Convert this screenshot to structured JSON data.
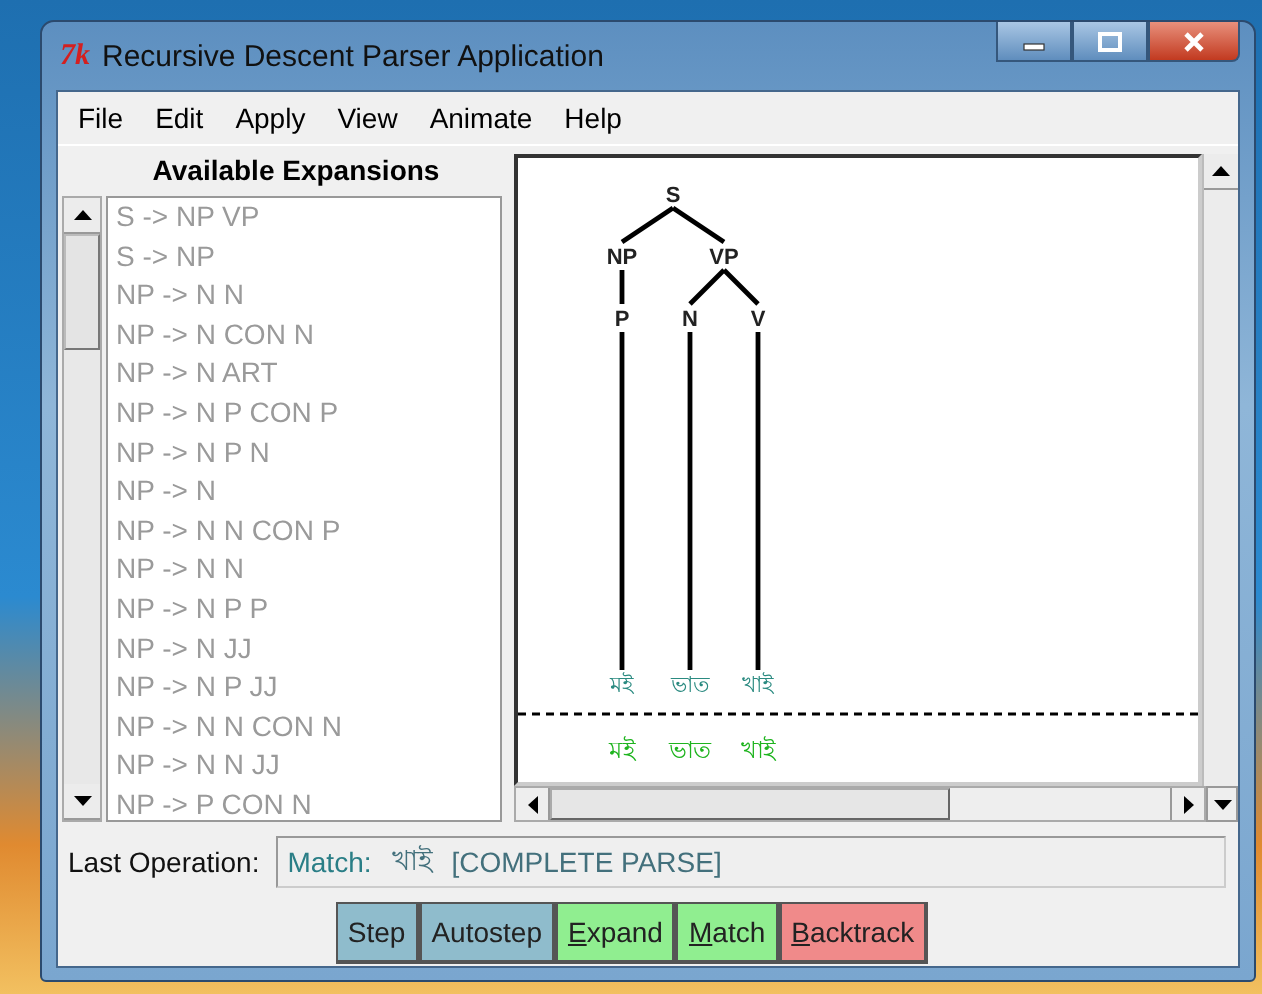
{
  "window": {
    "logo": "7k",
    "title": "Recursive Descent Parser Application"
  },
  "menu": [
    "File",
    "Edit",
    "Apply",
    "View",
    "Animate",
    "Help"
  ],
  "expansions": {
    "title": "Available Expansions",
    "items": [
      "S -> NP VP",
      "S -> NP",
      "NP -> N N",
      "NP -> N CON N",
      "NP -> N ART",
      "NP -> N P CON P",
      "NP -> N P N",
      "NP -> N",
      "NP -> N N CON P",
      "NP -> N N",
      "NP -> N P P",
      "NP -> N JJ",
      "NP -> N P JJ",
      "NP -> N N CON N",
      "NP -> N N JJ",
      "NP -> P CON N"
    ]
  },
  "tree": {
    "label": "S",
    "children": [
      {
        "label": "NP",
        "children": [
          {
            "label": "P",
            "children": [
              {
                "label": "মই"
              }
            ]
          }
        ]
      },
      {
        "label": "VP",
        "children": [
          {
            "label": "N",
            "children": [
              {
                "label": "ভাত"
              }
            ]
          },
          {
            "label": "V",
            "children": [
              {
                "label": "খাই"
              }
            ]
          }
        ]
      }
    ]
  },
  "tokens": [
    "মই",
    "ভাত",
    "খাই"
  ],
  "last_operation": {
    "label": "Last Operation:",
    "action": "Match:",
    "word": "খাই",
    "status": "[COMPLETE PARSE]"
  },
  "buttons": [
    {
      "label": "Step",
      "underline_first": false,
      "color": "#8fbccc"
    },
    {
      "label": "Autostep",
      "underline_first": false,
      "color": "#8fbccc"
    },
    {
      "label": "Expand",
      "underline_first": true,
      "color": "#90ee90"
    },
    {
      "label": "Match",
      "underline_first": true,
      "color": "#90ee90"
    },
    {
      "label": "Backtrack",
      "underline_first": true,
      "color": "#f08a8a"
    }
  ]
}
